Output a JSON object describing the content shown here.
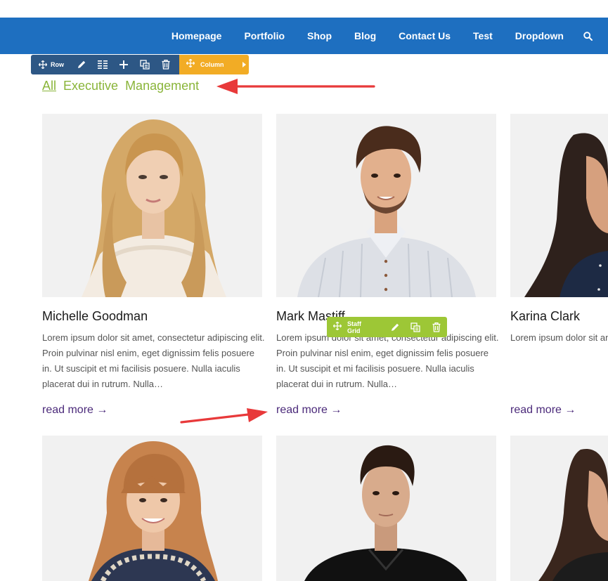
{
  "nav": {
    "items": [
      "Homepage",
      "Portfolio",
      "Shop",
      "Blog",
      "Contact Us",
      "Test",
      "Dropdown"
    ],
    "search_icon": "search-icon"
  },
  "builder": {
    "row_label": "Row",
    "column_label": "Column",
    "staff_grid_label": "Staff Grid",
    "row_color": "#2d5785",
    "column_color": "#f2ac25",
    "staff_color": "#9dc736"
  },
  "filters": {
    "items": [
      "All",
      "Executive",
      "Management"
    ],
    "active": "All",
    "color": "#8ab53a"
  },
  "staff": [
    {
      "name": "Michelle Goodman",
      "excerpt": "Lorem ipsum dolor sit amet, consectetur adipiscing elit. Proin pulvinar nisl enim, eget dignissim felis posuere in. Ut suscipit et mi facilisis posuere. Nulla iaculis placerat dui in rutrum. Nulla…",
      "read_more": "read more →"
    },
    {
      "name": "Mark Mastiff",
      "excerpt": "Lorem ipsum dolor sit amet, consectetur adipiscing elit. Proin pulvinar nisl enim, eget dignissim felis posuere in. Ut suscipit et mi facilisis posuere. Nulla iaculis placerat dui in rutrum. Nulla…",
      "read_more": "read more →"
    },
    {
      "name": "Karina Clark",
      "excerpt": "Lorem ipsum dolor sit amet, consectetur adipiscing elit. Proin pulvinar nisl enim, eget dignissim felis posuere in. Ut suscipit et mi facilisis posuere. Nulla iaculis placerat dui in rutrum. Nulla…",
      "read_more": "read more →"
    }
  ],
  "colors": {
    "nav_bg": "#1e6fc0",
    "link": "#4b2a7a",
    "arrow": "#e8393a"
  }
}
